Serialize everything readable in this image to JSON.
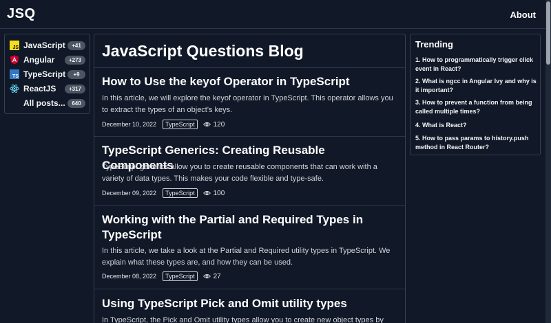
{
  "header": {
    "logo": "JSQ",
    "about_label": "About"
  },
  "sidebar": {
    "items": [
      {
        "label": "JavaScript",
        "count": "+41",
        "icon": "javascript-icon"
      },
      {
        "label": "Angular",
        "count": "+273",
        "icon": "angular-icon"
      },
      {
        "label": "TypeScript",
        "count": "+9",
        "icon": "typescript-icon"
      },
      {
        "label": "ReactJS",
        "count": "+317",
        "icon": "react-icon"
      },
      {
        "label": "All posts...",
        "count": "640"
      }
    ]
  },
  "main": {
    "title": "JavaScript Questions Blog",
    "posts": [
      {
        "title": "How to Use the keyof Operator in TypeScript",
        "excerpt": "In this article, we will explore the keyof operator in TypeScript. This operator allows you to extract the types of an object's keys.",
        "date": "December 10, 2022",
        "tag": "TypeScript",
        "views": "120"
      },
      {
        "title": "TypeScript Generics: Creating Reusable Components",
        "excerpt": "TypeScript generics allow you to create reusable components that can work with a variety of data types. This makes your code flexible and type-safe.",
        "date": "December 09, 2022",
        "tag": "TypeScript",
        "views": "100"
      },
      {
        "title": "Working with the Partial and Required Types in TypeScript",
        "excerpt": "In this article, we take a look at the Partial and Required utility types in TypeScript. We explain what these types are, and how they can be used.",
        "date": "December 08, 2022",
        "tag": "TypeScript",
        "views": "27"
      },
      {
        "title": "Using TypeScript Pick and Omit utility types",
        "excerpt": "In TypeScript, the Pick and Omit utility types allow you to create new object types by"
      }
    ]
  },
  "trending": {
    "title": "Trending",
    "items": [
      "1. How to programmatically trigger click event in React?",
      "2. What is ngcc in Angular Ivy and why is it important?",
      "3. How to prevent a function from being called multiple times?",
      "4. What is React?",
      "5. How to pass params to history.push method in React Router?"
    ]
  },
  "colors": {
    "background": "#111827",
    "border": "#374151",
    "badge": "#4b5563",
    "javascript": "#f7df1e",
    "angular": "#dd0031",
    "typescript": "#3178c6",
    "react": "#61dafb"
  }
}
